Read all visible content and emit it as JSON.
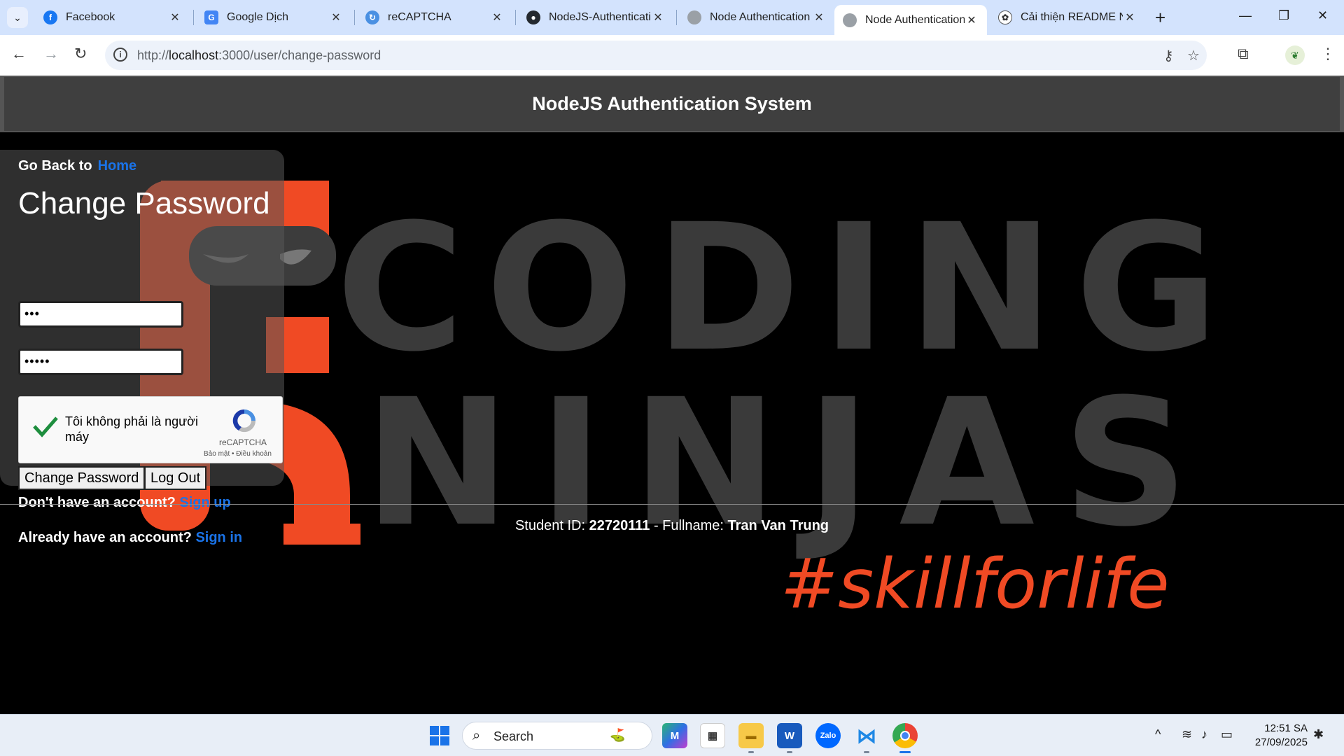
{
  "browser": {
    "tabs": [
      {
        "label": "Facebook",
        "icon": "facebook-icon"
      },
      {
        "label": "Google Dịch",
        "icon": "google-translate-icon"
      },
      {
        "label": "reCAPTCHA",
        "icon": "recaptcha-icon"
      },
      {
        "label": "NodeJS-Authenticati",
        "icon": "github-icon"
      },
      {
        "label": "Node Authentication",
        "icon": "globe-icon"
      },
      {
        "label": "Node Authentication",
        "icon": "globe-icon"
      },
      {
        "label": "Cải thiện README N",
        "icon": "chatgpt-icon"
      }
    ],
    "active_tab_index": 5,
    "url_prefix": "http://",
    "url_host": "localhost",
    "url_path": ":3000/user/change-password"
  },
  "page": {
    "header_title": "NodeJS Authentication System",
    "go_back_text": "Go Back to",
    "go_back_link": "Home",
    "form_title": "Change Password",
    "password1_value": "•••",
    "password2_value": "•••••",
    "recaptcha": {
      "label": "Tôi không phải là người máy",
      "brand": "reCAPTCHA",
      "terms": "Bảo mật • Điều khoản",
      "checked": true
    },
    "change_button": "Change Password",
    "logout_button": "Log Out",
    "no_account_text": "Don't have an account?",
    "signup_link": "Sign up",
    "have_account_text": "Already have an account?",
    "signin_link": "Sign in",
    "footer": {
      "id_label": "Student ID:",
      "id_value": "22720111",
      "sep": "- Fullname:",
      "name_value": "Tran Van Trung"
    },
    "background": {
      "line1": "CODING",
      "line2": "NINJAS",
      "tagline": "#skillforlife"
    }
  },
  "taskbar": {
    "search_label": "Search",
    "time": "12:51 SA",
    "date": "27/09/2025"
  },
  "colors": {
    "link": "#1a73e8",
    "ninja_orange": "#f04a24",
    "header_bg": "#3f3f3f"
  }
}
